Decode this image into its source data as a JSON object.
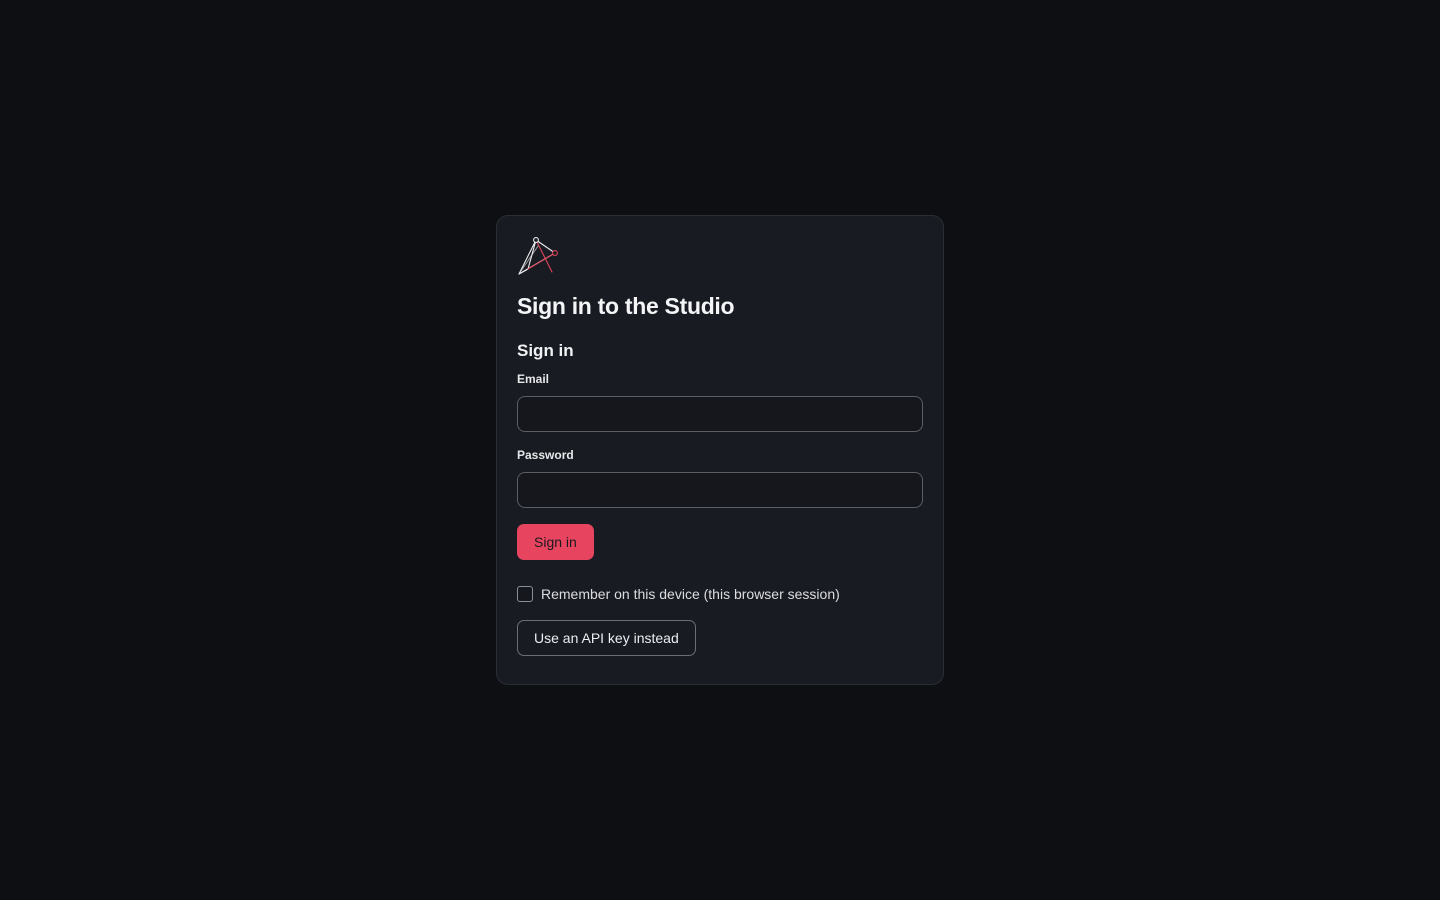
{
  "header": {
    "logo_icon": "studio-logo-icon",
    "title": "Sign in to the Studio"
  },
  "form": {
    "section_title": "Sign in",
    "email": {
      "label": "Email",
      "value": "",
      "placeholder": ""
    },
    "password": {
      "label": "Password",
      "value": "",
      "placeholder": ""
    },
    "submit_label": "Sign in",
    "remember": {
      "label": "Remember on this device (this browser session)",
      "checked": false
    },
    "api_key_label": "Use an API key instead"
  },
  "colors": {
    "background": "#0e0f13",
    "card": "#181b21",
    "accent": "#e6445f",
    "logo_accent": "#e0455a"
  }
}
